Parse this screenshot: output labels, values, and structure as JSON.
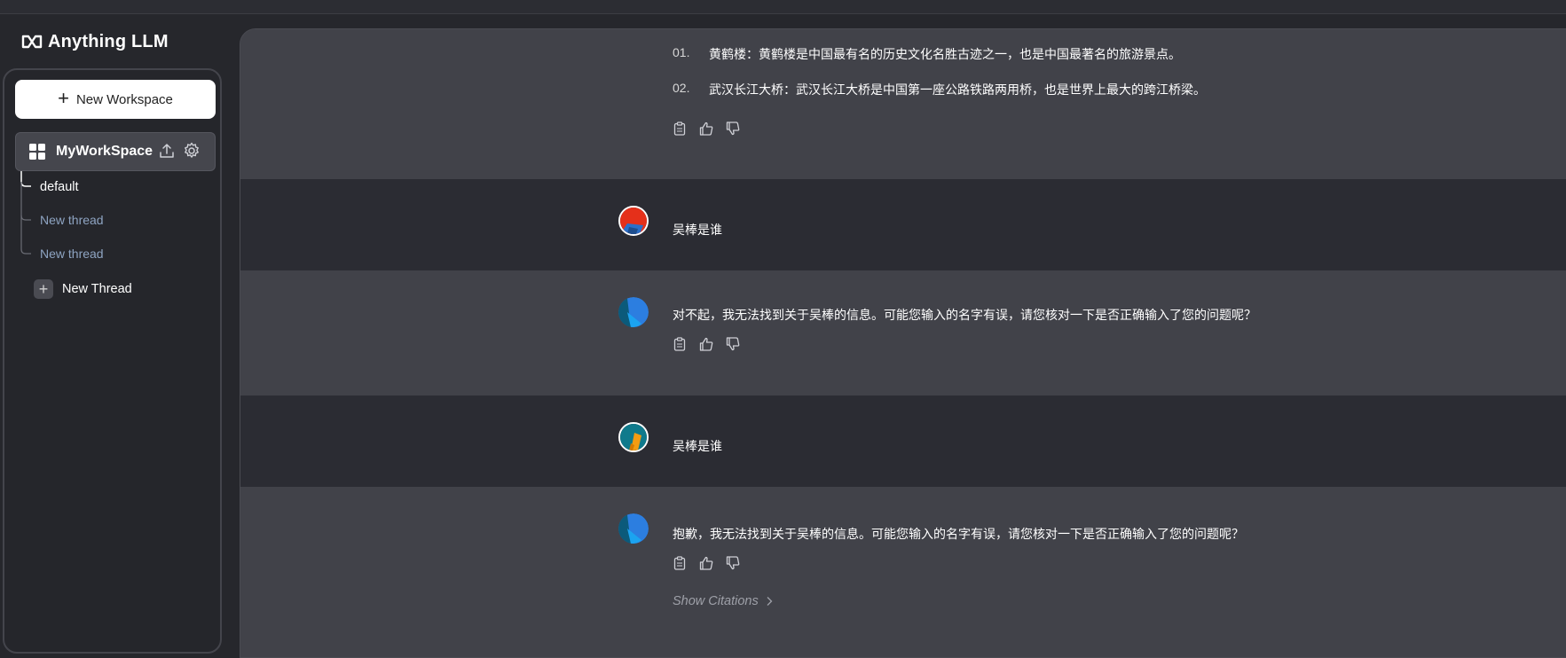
{
  "app": {
    "title": "Anything LLM"
  },
  "sidebar": {
    "new_workspace_label": "New Workspace",
    "workspace": {
      "name": "MyWorkSpace"
    },
    "threads": [
      {
        "label": "default"
      },
      {
        "label": "New thread"
      },
      {
        "label": "New thread"
      }
    ],
    "new_thread_label": "New Thread"
  },
  "chat": {
    "top_list": [
      {
        "num": "01.",
        "text": "黄鹤楼：黄鹤楼是中国最有名的历史文化名胜古迹之一，也是中国最著名的旅游景点。"
      },
      {
        "num": "02.",
        "text": "武汉长江大桥：武汉长江大桥是中国第一座公路铁路两用桥，也是世界上最大的跨江桥梁。"
      }
    ],
    "messages": [
      {
        "role": "user",
        "text": "吴棒是谁"
      },
      {
        "role": "assistant",
        "text": "对不起，我无法找到关于吴棒的信息。可能您输入的名字有误，请您核对一下是否正确输入了您的问题呢？"
      },
      {
        "role": "user",
        "text": "吴棒是谁"
      },
      {
        "role": "assistant",
        "text": "抱歉，我无法找到关于吴棒的信息。可能您输入的名字有误，请您核对一下是否正确输入了您的问题呢？"
      }
    ],
    "show_citations_label": "Show Citations"
  },
  "colors": {
    "background": "#26272c",
    "assistant_row": "#414249",
    "user_row": "#2b2c33",
    "thread_muted": "#8ea4c2"
  }
}
